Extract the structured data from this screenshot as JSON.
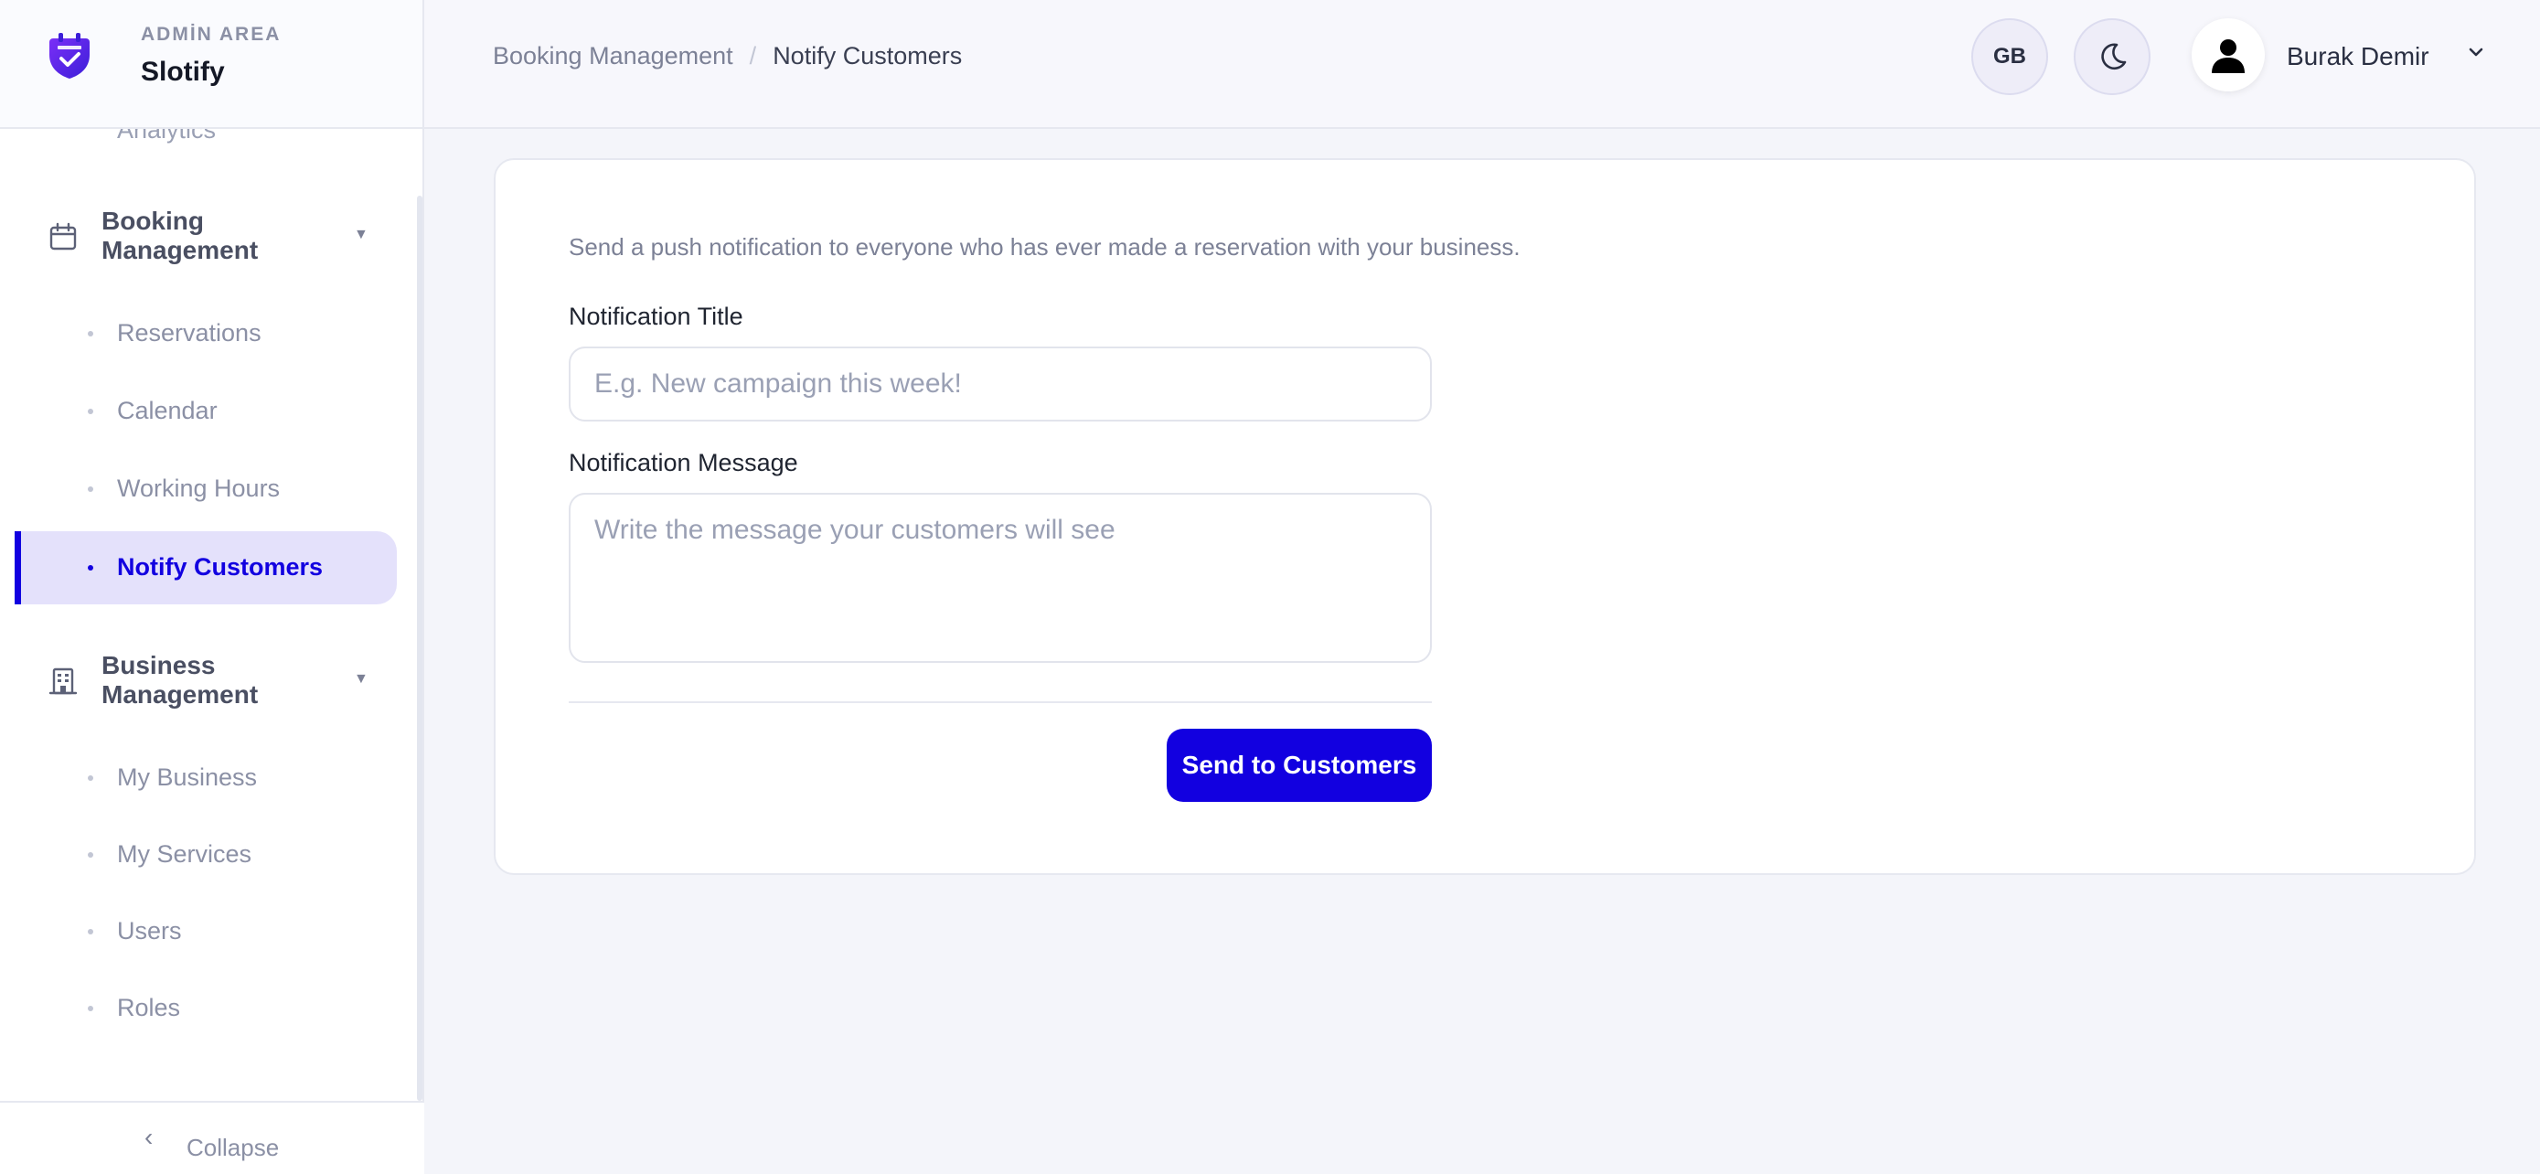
{
  "brand": {
    "area_label": "ADMİN AREA",
    "app_name": "Slotify"
  },
  "sidebar": {
    "cut_item": "Analytics",
    "groups": [
      {
        "label": "Booking Management",
        "items": [
          "Reservations",
          "Calendar",
          "Working Hours",
          "Notify Customers"
        ],
        "active": "Notify Customers"
      },
      {
        "label": "Business Management",
        "items": [
          "My Business",
          "My Services",
          "Users",
          "Roles"
        ]
      }
    ],
    "collapse_label": "Collapse"
  },
  "header": {
    "breadcrumb": [
      "Booking Management",
      "Notify Customers"
    ],
    "lang_code": "GB",
    "user_name": "Burak Demir"
  },
  "form": {
    "description": "Send a push notification to everyone who has ever made a reservation with your business.",
    "title_label": "Notification Title",
    "title_placeholder": "E.g. New campaign this week!",
    "message_label": "Notification Message",
    "message_placeholder": "Write the message your customers will see",
    "submit_label": "Send to Customers"
  },
  "colors": {
    "accent": "#1200e0",
    "active_bg": "#e4e1fb"
  }
}
